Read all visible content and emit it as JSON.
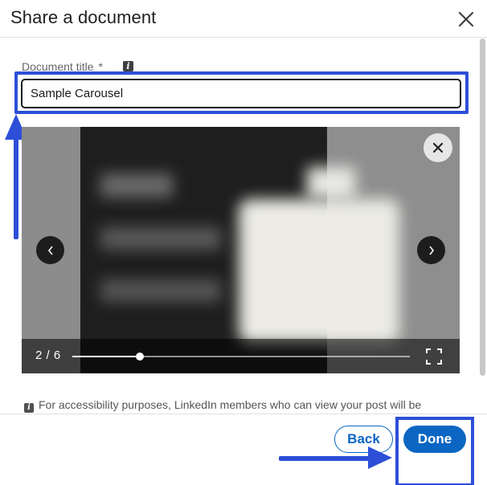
{
  "dialog": {
    "title": "Share a document",
    "close_icon": "close-icon"
  },
  "form": {
    "label": "Document title",
    "required_marker": "*",
    "info_icon": "info-icon",
    "value": "Sample Carousel"
  },
  "preview": {
    "page_counter": "2 / 6",
    "current_page": 2,
    "total_pages": 6,
    "progress_fraction": 0.2,
    "icons": {
      "remove": "close-icon",
      "prev": "chevron-left-icon",
      "next": "chevron-right-icon",
      "fullscreen": "fullscreen-icon"
    }
  },
  "note": {
    "text": "For accessibility purposes, LinkedIn members who can view your post will be"
  },
  "footer": {
    "back_label": "Back",
    "done_label": "Done"
  },
  "colors": {
    "accent": "#0a66c2",
    "annotation": "#2d4fd8"
  }
}
